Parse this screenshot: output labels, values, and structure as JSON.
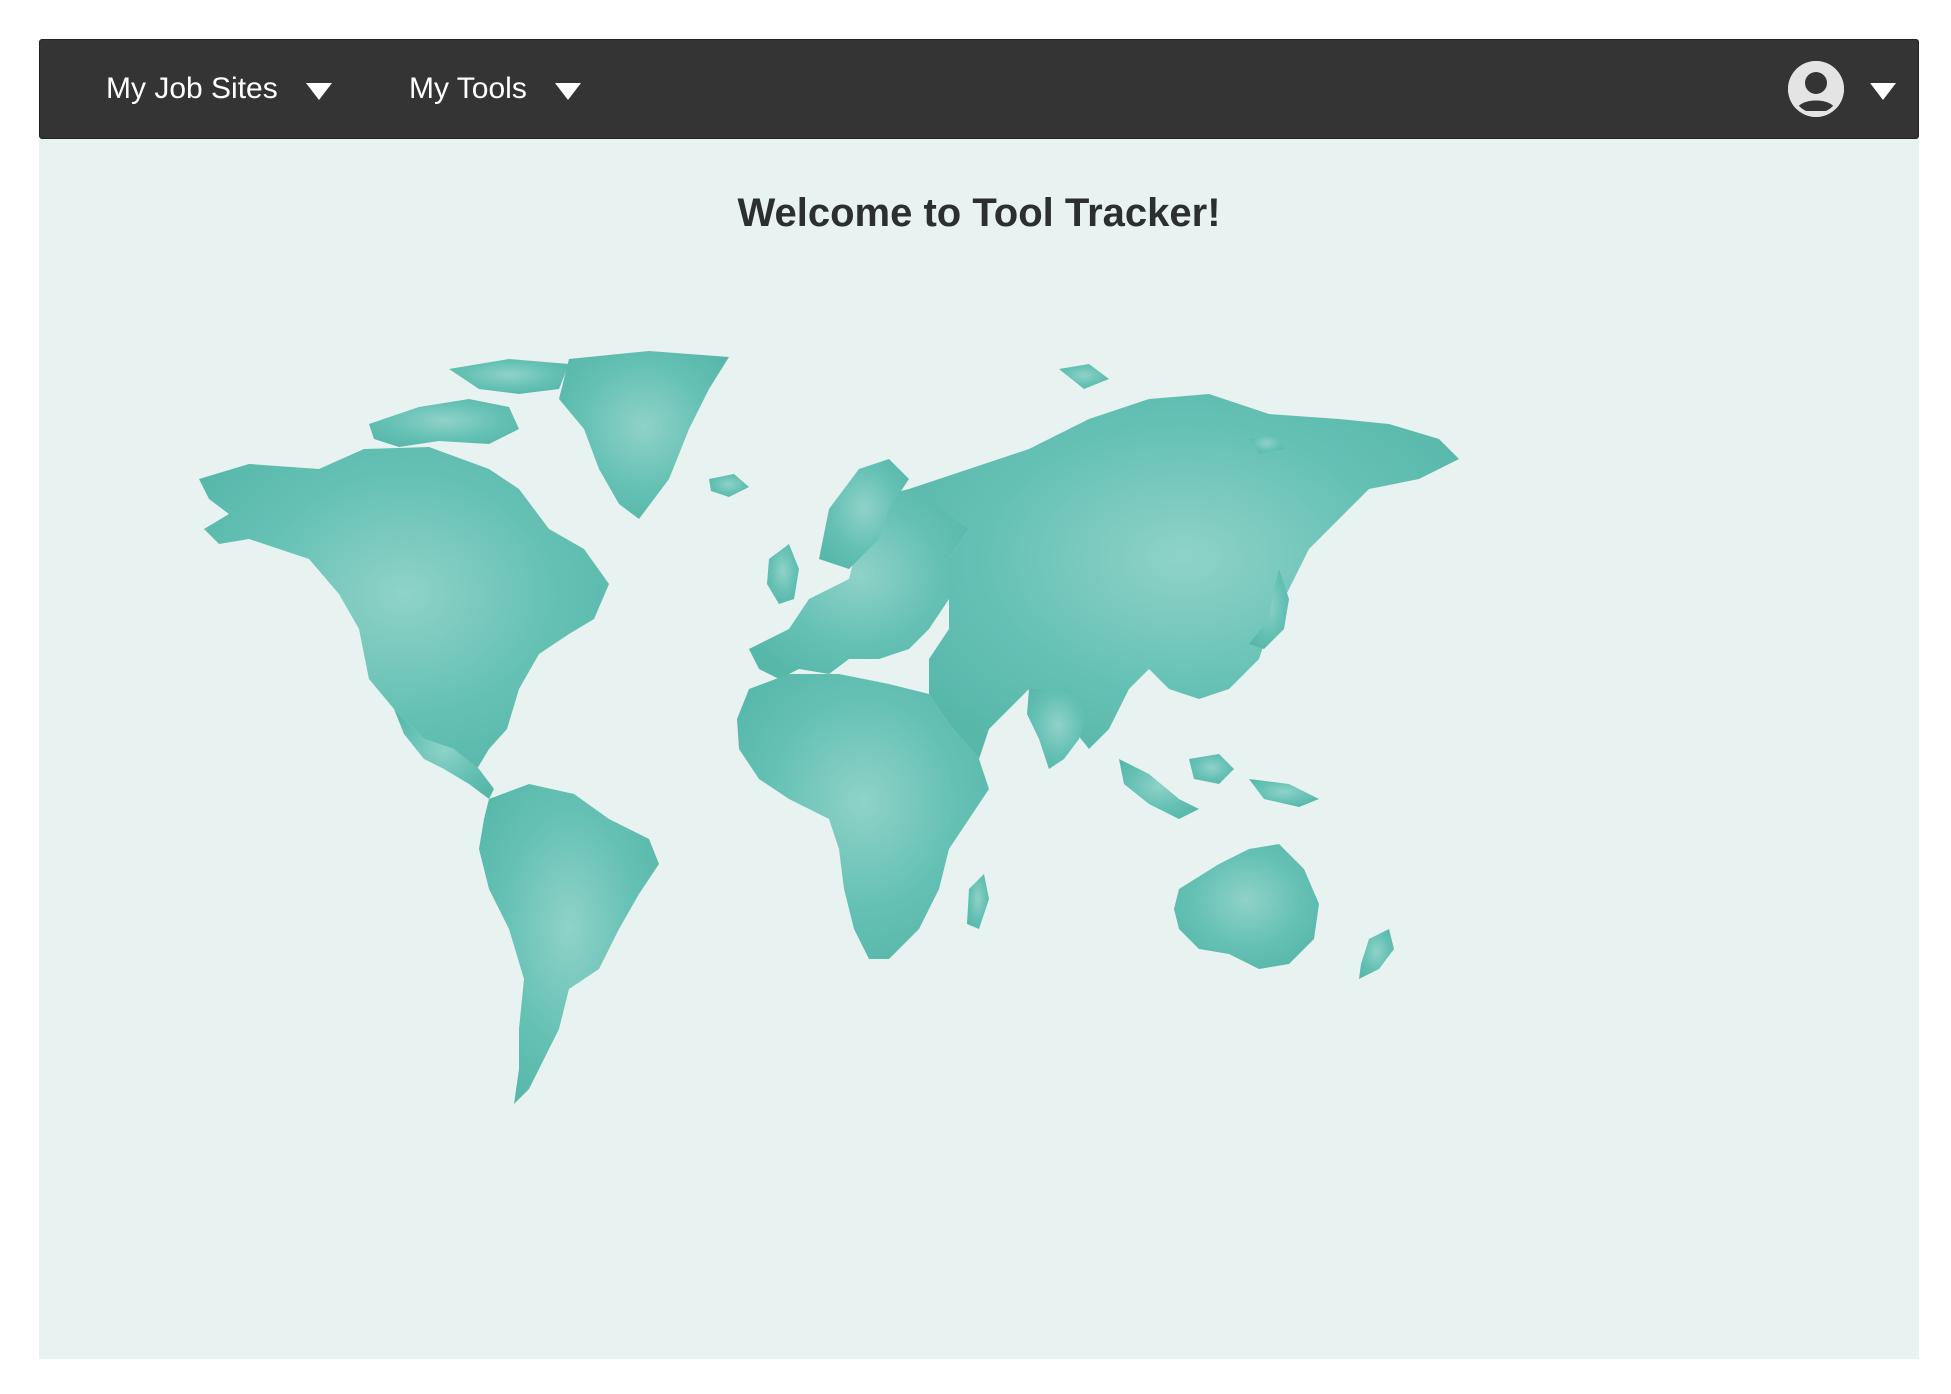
{
  "navbar": {
    "menus": [
      {
        "label": "My Job Sites",
        "icon": "caret-down-icon"
      },
      {
        "label": "My Tools",
        "icon": "caret-down-icon"
      }
    ],
    "user": {
      "avatar_icon": "user-avatar-icon",
      "menu_icon": "caret-down-icon"
    }
  },
  "main": {
    "heading": "Welcome to Tool Tracker!",
    "background_image": "world-map",
    "map_color": "#5dbfb1",
    "background_color": "#e8f2f0"
  },
  "colors": {
    "navbar": "#343434",
    "nav_text": "#ffffff",
    "heading_text": "#2b2f30"
  }
}
